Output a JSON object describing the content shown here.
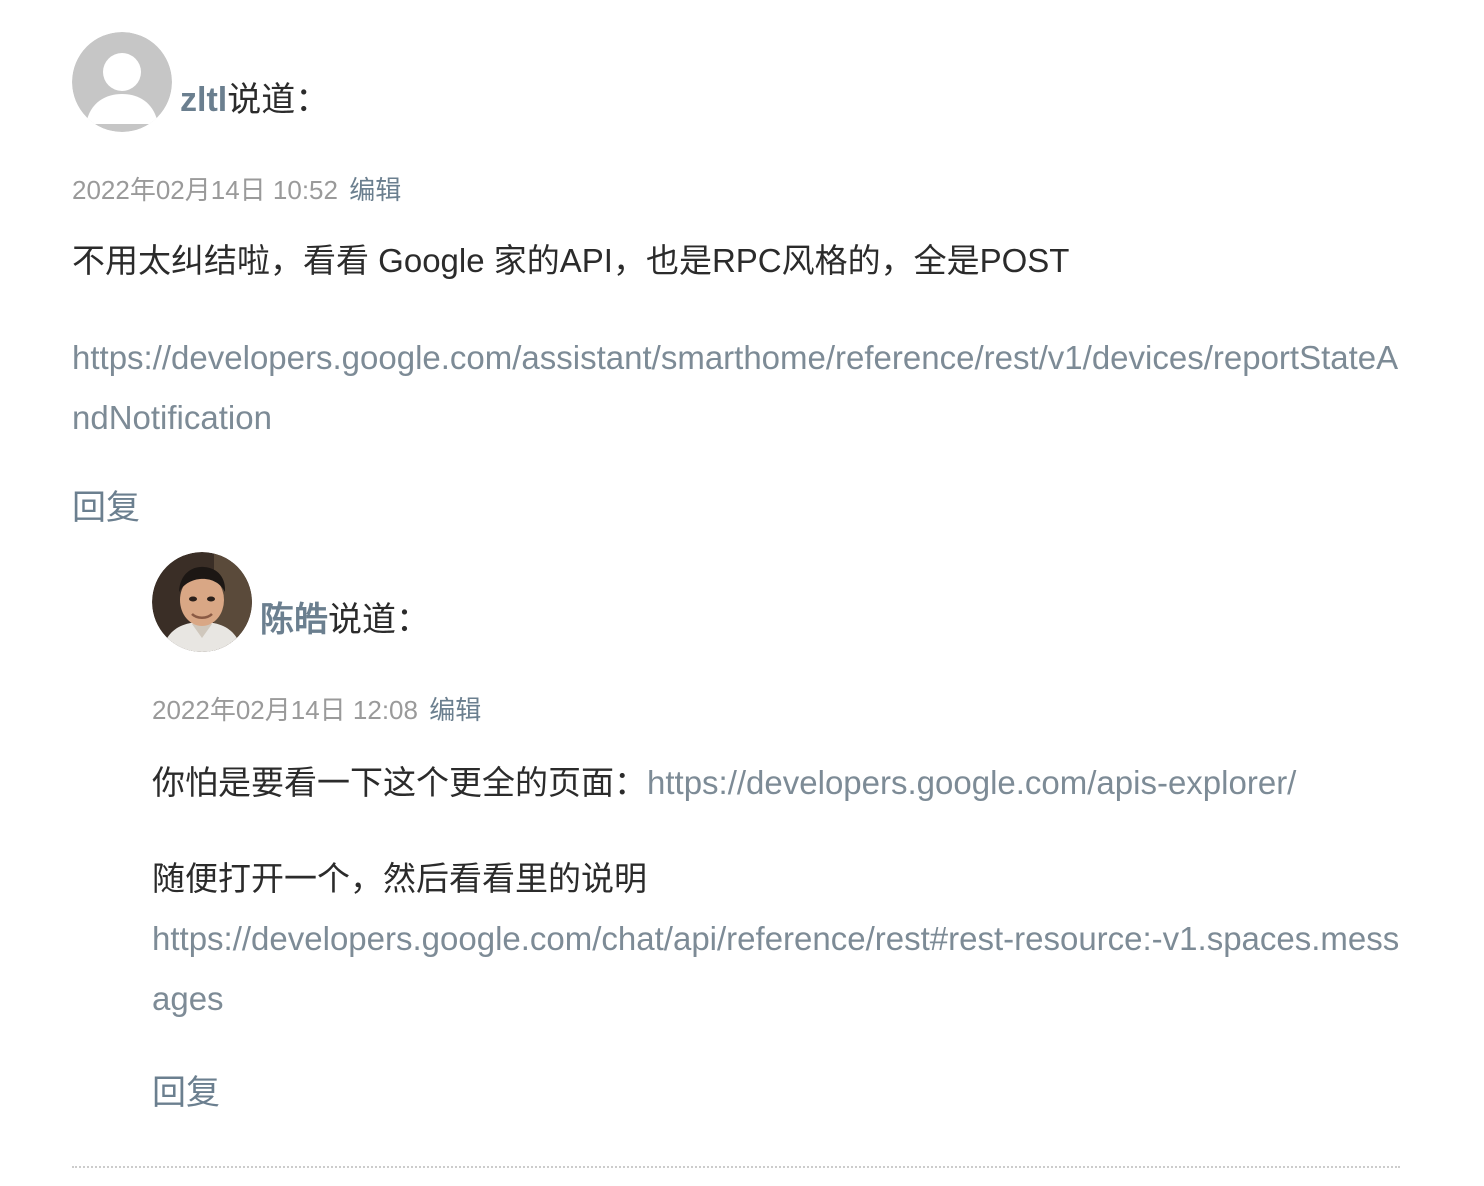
{
  "comments": [
    {
      "author": "zltl",
      "said": "说道：",
      "date": "2022年02月14日 10:52",
      "edit_label": "编辑",
      "text": "不用太纠结啦，看看 Google 家的API，也是RPC风格的，全是POST",
      "link": "https://developers.google.com/assistant/smarthome/reference/rest/v1/devices/reportStateAndNotification",
      "reply_label": "回复",
      "avatar_icon": "default-avatar-icon"
    },
    {
      "author": "陈皓",
      "said": "说道：",
      "date": "2022年02月14日 12:08",
      "edit_label": "编辑",
      "text1": "你怕是要看一下这个更全的页面：",
      "link1": "https://developers.google.com/apis-explorer/",
      "text2": "随便打开一个，然后看看里的说明",
      "link2": "https://developers.google.com/chat/api/reference/rest#rest-resource:-v1.spaces.messages",
      "reply_label": "回复",
      "avatar_icon": "user-photo-avatar"
    }
  ],
  "colors": {
    "link": "#7d8b96",
    "author": "#6b7f8f",
    "meta": "#9a9a9a",
    "text": "#2b2b2b"
  }
}
